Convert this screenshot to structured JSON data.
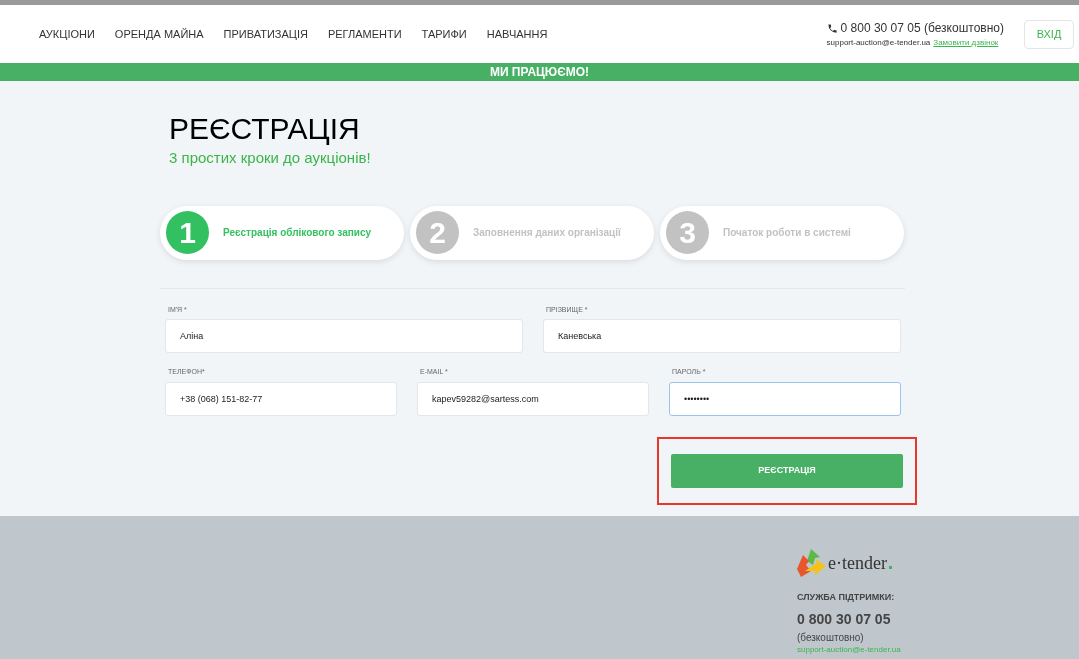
{
  "nav": {
    "items": [
      "АУКЦІОНИ",
      "ОРЕНДА МАЙНА",
      "ПРИВАТИЗАЦІЯ",
      "РЕГЛАМЕНТИ",
      "ТАРИФИ",
      "НАВЧАННЯ"
    ],
    "phone": "0 800 30 07 05 (безкоштовно)",
    "email": "support-auction@e-tender.ua",
    "callback_link": "Замовити дзвінок",
    "login_button": "ВХІД"
  },
  "banner": "МИ ПРАЦЮЄМО!",
  "heading": {
    "title": "РЕЄСТРАЦІЯ",
    "subtitle": "3 простих кроки до аукціонів!"
  },
  "steps": [
    {
      "number": "1",
      "label": "Реєстрація облікового запису",
      "selected": true
    },
    {
      "number": "2",
      "label": "Заповнення даних організації",
      "selected": false
    },
    {
      "number": "3",
      "label": "Початок роботи в системі",
      "selected": false
    }
  ],
  "form": {
    "rows": [
      [
        {
          "label": "ІМ'Я *",
          "value": "Аліна",
          "focused": false
        },
        {
          "label": "ПРІЗВИЩЕ *",
          "value": "Каневська",
          "focused": false
        }
      ],
      [
        {
          "label": "ТЕЛЕФОН*",
          "value": "+38 (068) 151-82-77",
          "focused": false
        },
        {
          "label": "E-MAIL *",
          "value": "kapev59282@sartess.com",
          "focused": false
        },
        {
          "label": "ПАРОЛЬ *",
          "value": "••••••••",
          "focused": true
        }
      ]
    ],
    "submit_button": "РЕЄСТРАЦІЯ"
  },
  "footer": {
    "logo": "e·tender",
    "support_title": "СЛУЖБА ПІДТРИМКИ:",
    "phone": "0 800 30 07 05",
    "phone_note": "(безкоштовно)",
    "email": "support-auction@e-tender.ua"
  }
}
